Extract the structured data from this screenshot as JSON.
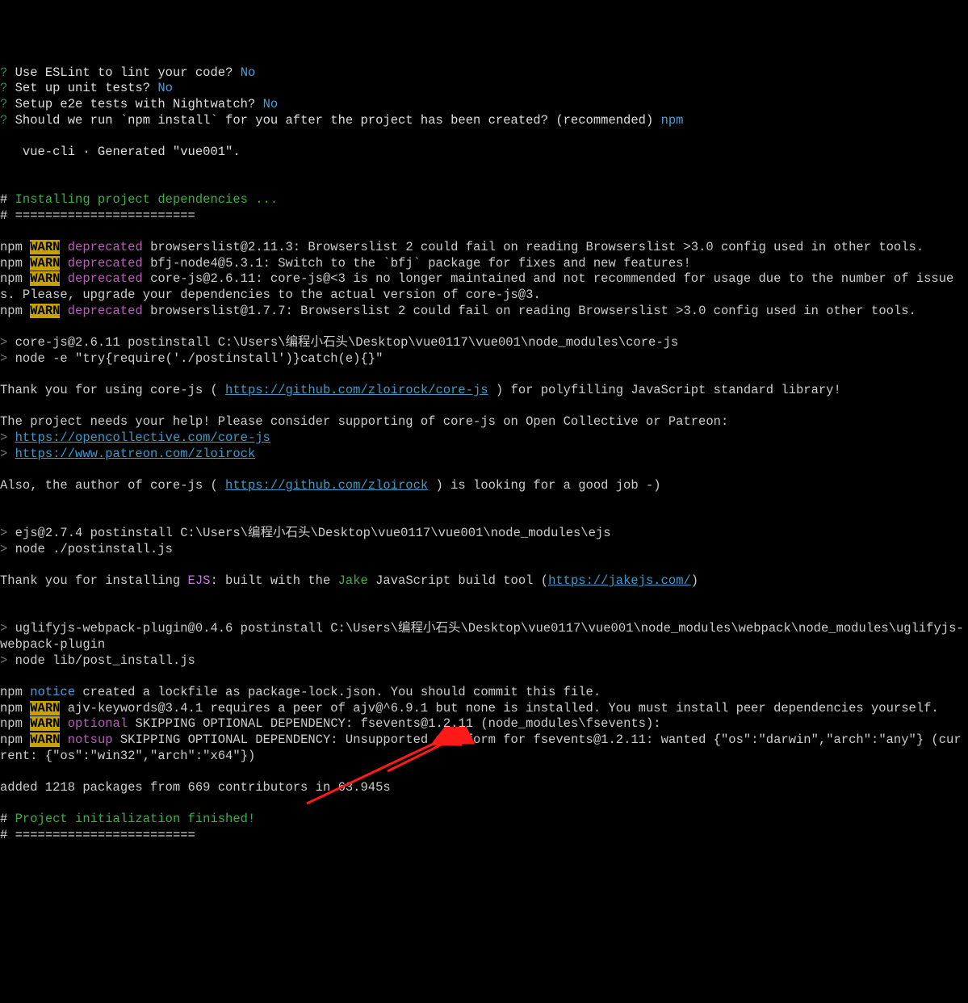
{
  "prompts": {
    "eslint_q": "Use ESLint to lint your code?",
    "eslint_a": "No",
    "unit_q": "Set up unit tests?",
    "unit_a": "No",
    "e2e_q": "Setup e2e tests with Nightwatch?",
    "e2e_a": "No",
    "npm_q": "Should we run `npm install` for you after the project has been created? (recommended)",
    "npm_a": "npm"
  },
  "generated": "   vue-cli · Generated \"vue001\".",
  "section_install": "Installing project dependencies ...",
  "rule": "========================",
  "warn_label": "WARN",
  "deprecated_label": "deprecated",
  "warns": {
    "w1": " browserslist@2.11.3: Browserslist 2 could fail on reading Browserslist >3.0 config used in other tools.",
    "w2": " bfj-node4@5.3.1: Switch to the `bfj` package for fixes and new features!",
    "w3": " core-js@2.6.11: core-js@<3 is no longer maintained and not recommended for usage due to the number of issues. Please, upgrade your dependencies to the actual version of core-js@3.",
    "w4": " browserslist@1.7.7: Browserslist 2 could fail on reading Browserslist >3.0 config used in other tools."
  },
  "postinstall_corejs_1": "core-js@2.6.11 postinstall C:\\Users\\编程小石头\\Desktop\\vue0117\\vue001\\node_modules\\core-js",
  "postinstall_corejs_2": "node -e \"try{require('./postinstall')}catch(e){}\"",
  "thanks_corejs_pre": "Thank you for using core-js ( ",
  "corejs_link": "https://github.com/zloirock/core-js",
  "thanks_corejs_post": " ) for polyfilling JavaScript standard library!",
  "support_line": "The project needs your help! Please consider supporting of core-js on Open Collective or Patreon:",
  "oc_link": "https://opencollective.com/core-js",
  "patreon_link": "https://www.patreon.com/zloirock",
  "author_pre": "Also, the author of core-js ( ",
  "author_link": "https://github.com/zloirock",
  "author_post": " ) is looking for a good job -)",
  "ejs_post1": "ejs@2.7.4 postinstall C:\\Users\\编程小石头\\Desktop\\vue0117\\vue001\\node_modules\\ejs",
  "ejs_post2": "node ./postinstall.js",
  "ejs_thanks_pre": "Thank you for installing ",
  "ejs_label": "EJS",
  "ejs_mid": ": built with the ",
  "jake_label": "Jake",
  "ejs_mid2": " JavaScript build tool (",
  "jake_link": "https://jakejs.com/",
  "ejs_end": ")",
  "uglify1": "uglifyjs-webpack-plugin@0.4.6 postinstall C:\\Users\\编程小石头\\Desktop\\vue0117\\vue001\\node_modules\\webpack\\node_modules\\uglifyjs-webpack-plugin",
  "uglify2": "node lib/post_install.js",
  "notice_label": "notice",
  "notice_txt": " created a lockfile as package-lock.json. You should commit this file.",
  "peer_warn": " ajv-keywords@3.4.1 requires a peer of ajv@^6.9.1 but none is installed. You must install peer dependencies yourself.",
  "optional_label": "optional",
  "optional_txt": " SKIPPING OPTIONAL DEPENDENCY: fsevents@1.2.11 (node_modules\\fsevents):",
  "notsup_label": "notsup",
  "notsup_txt": " SKIPPING OPTIONAL DEPENDENCY: Unsupported platform for fsevents@1.2.11: wanted {\"os\":\"darwin\",\"arch\":\"any\"} (current: {\"os\":\"win32\",\"arch\":\"x64\"})",
  "added": "added 1218 packages from 669 contributors in 63.945s",
  "finished": "Project initialization finished!",
  "npm_prefix": "npm "
}
